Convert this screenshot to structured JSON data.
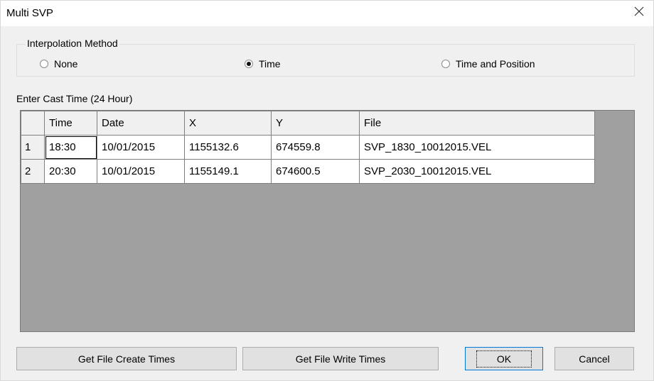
{
  "window": {
    "title": "Multi SVP",
    "close_icon": "close-icon"
  },
  "interpolation": {
    "legend": "Interpolation Method",
    "options": [
      {
        "label": "None",
        "checked": false
      },
      {
        "label": "Time",
        "checked": true
      },
      {
        "label": "Time and Position",
        "checked": false
      }
    ]
  },
  "cast": {
    "label": "Enter Cast Time (24 Hour)"
  },
  "grid": {
    "columns": [
      "Time",
      "Date",
      "X",
      "Y",
      "File"
    ],
    "rows": [
      {
        "index": "1",
        "time": "18:30",
        "date": "10/01/2015",
        "x": "1155132.6",
        "y": "674559.8",
        "file": "SVP_1830_10012015.VEL"
      },
      {
        "index": "2",
        "time": "20:30",
        "date": "10/01/2015",
        "x": "1155149.1",
        "y": "674600.5",
        "file": "SVP_2030_10012015.VEL"
      }
    ],
    "background": "#a0a0a0"
  },
  "buttons": {
    "get_create": "Get File Create Times",
    "get_write": "Get File Write Times",
    "ok": "OK",
    "cancel": "Cancel"
  }
}
